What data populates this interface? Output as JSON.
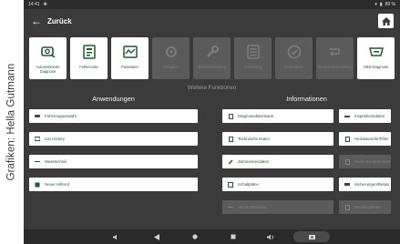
{
  "credit": "Grafiken: Hella Gutmann",
  "status": {
    "time": "14:41",
    "battery": "89 %"
  },
  "appbar": {
    "title": "Zurück"
  },
  "tiles": [
    {
      "label": "Automatisierte Diagnose",
      "icon": "car-diagnosis-icon",
      "enabled": true
    },
    {
      "label": "Fehlercode",
      "icon": "error-code-icon",
      "enabled": true
    },
    {
      "label": "Parameter",
      "icon": "parameter-icon",
      "enabled": true
    },
    {
      "label": "Stellglied",
      "icon": "actuator-icon",
      "enabled": false
    },
    {
      "label": "Grundeinstellung",
      "icon": "wrench-icon",
      "enabled": false
    },
    {
      "label": "Codierung",
      "icon": "coding-icon",
      "enabled": false
    },
    {
      "label": "Testfunktion",
      "icon": "check-icon",
      "enabled": false
    },
    {
      "label": "Service-Rückstellung",
      "icon": "service-reset-icon",
      "enabled": false
    },
    {
      "label": "OBD-Diagnose",
      "icon": "obd-icon",
      "enabled": true
    }
  ],
  "section_title": "Weitere Funktionen",
  "left": {
    "heading": "Anwendungen",
    "items": [
      {
        "label": "Fahrzeugauswahl",
        "enabled": true
      },
      {
        "label": "Car History",
        "enabled": true
      },
      {
        "label": "Messtechnik",
        "enabled": true
      },
      {
        "label": "Neuer Hilferuf",
        "enabled": true
      }
    ]
  },
  "right": {
    "heading": "Informationen",
    "items": [
      {
        "label": "Diagnosedatenbank",
        "enabled": true
      },
      {
        "label": "Technische Daten",
        "enabled": true
      },
      {
        "label": "Zahnriemendaten",
        "enabled": true
      },
      {
        "label": "Schaltpläne",
        "enabled": true
      },
      {
        "label": "Servicehinweise",
        "enabled": false
      }
    ]
  },
  "far_right": {
    "items": [
      {
        "label": "Inspektionsdaten",
        "enabled": true
      },
      {
        "label": "Heizwassrohr/Filter",
        "enabled": true
      },
      {
        "label": "Reifenkomponenten",
        "enabled": false
      },
      {
        "label": "Sicherungen/Relais",
        "enabled": true
      },
      {
        "label": "Dieselsysteme",
        "enabled": false
      }
    ]
  }
}
